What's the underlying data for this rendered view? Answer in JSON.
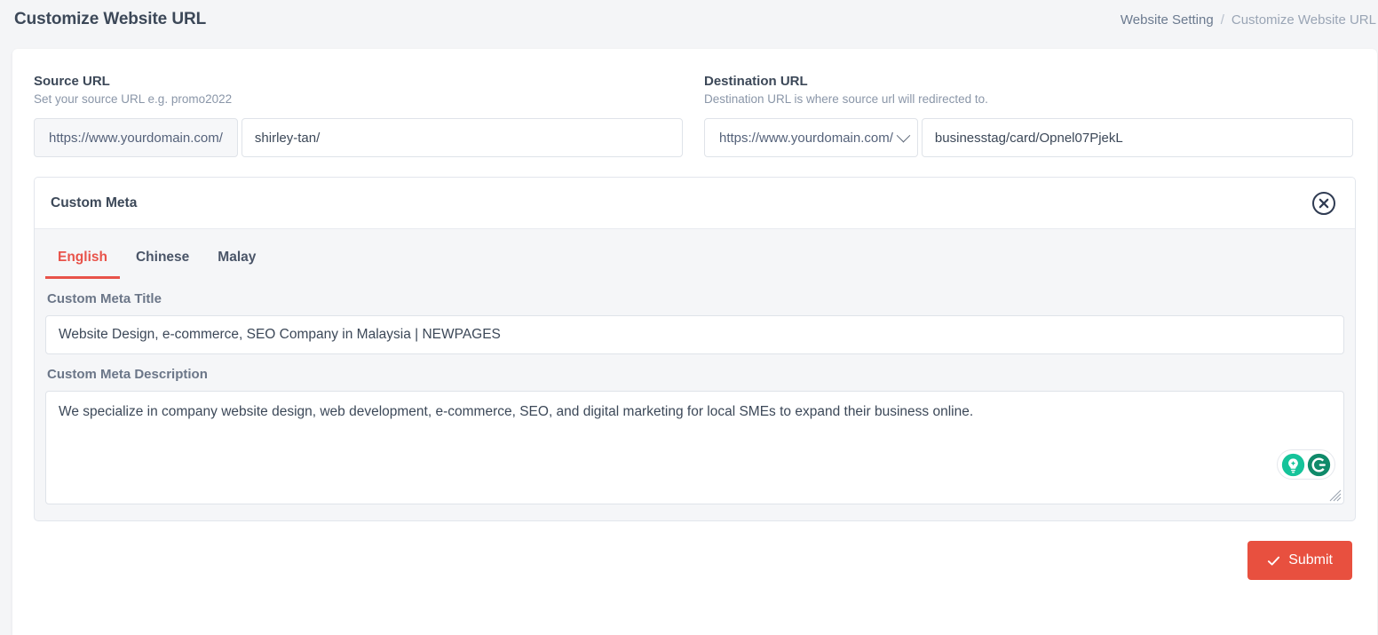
{
  "header": {
    "title": "Customize Website URL",
    "breadcrumb": {
      "parent": "Website Setting",
      "separator": "/",
      "current": "Customize Website URL"
    }
  },
  "source_url": {
    "label": "Source URL",
    "hint": "Set your source URL e.g. promo2022",
    "prefix": "https://www.yourdomain.com/",
    "value": "shirley-tan/",
    "placeholder": ""
  },
  "destination_url": {
    "label": "Destination URL",
    "hint": "Destination URL is where source url will redirected to.",
    "prefix_selected": "https://www.yourdomain.com/",
    "prefix_icon": "chevron-down-icon",
    "value": "businesstag/card/Opnel07PjekL",
    "placeholder": ""
  },
  "custom_meta": {
    "title": "Custom Meta",
    "close_icon": "close-circle-icon",
    "tabs": [
      {
        "label": "English",
        "active": true
      },
      {
        "label": "Chinese",
        "active": false
      },
      {
        "label": "Malay",
        "active": false
      }
    ],
    "meta_title": {
      "label": "Custom Meta Title",
      "value": "Website Design, e-commerce, SEO Company in Malaysia | NEWPAGES",
      "placeholder": ""
    },
    "meta_description": {
      "label": "Custom Meta Description",
      "value": "We specialize in company website design, web development, e-commerce, SEO, and digital marketing for local SMEs to expand their business online.",
      "placeholder": ""
    },
    "assistant_badge": {
      "icon_left": "lightbulb-icon",
      "icon_right": "grammarly-g-icon"
    }
  },
  "footer": {
    "submit_label": "Submit",
    "submit_icon": "check-icon"
  },
  "colors": {
    "accent_red": "#e8503f",
    "tab_active": "#e8534a",
    "page_bg": "#f4f5f7",
    "panel_bg": "#f5f6f8",
    "text_dark": "#3c4858",
    "text_muted": "#8a96a8",
    "grammarly_teal": "#15c39a",
    "grammarly_green": "#0f8a6a"
  }
}
